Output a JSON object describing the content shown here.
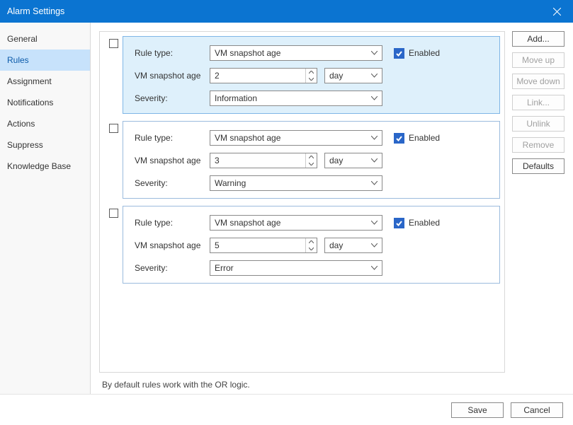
{
  "window": {
    "title": "Alarm Settings"
  },
  "sidebar": {
    "items": [
      {
        "label": "General"
      },
      {
        "label": "Rules",
        "selected": true
      },
      {
        "label": "Assignment"
      },
      {
        "label": "Notifications"
      },
      {
        "label": "Actions"
      },
      {
        "label": "Suppress"
      },
      {
        "label": "Knowledge Base"
      }
    ]
  },
  "labels": {
    "rule_type": "Rule type:",
    "vm_snapshot_age": "VM snapshot age",
    "severity": "Severity:",
    "enabled": "Enabled"
  },
  "rules": [
    {
      "type_value": "VM snapshot age",
      "age_value": "2",
      "unit": "day",
      "severity": "Information",
      "enabled": true,
      "selected": true
    },
    {
      "type_value": "VM snapshot age",
      "age_value": "3",
      "unit": "day",
      "severity": "Warning",
      "enabled": true,
      "selected": false
    },
    {
      "type_value": "VM snapshot age",
      "age_value": "5",
      "unit": "day",
      "severity": "Error",
      "enabled": true,
      "selected": false
    }
  ],
  "footnote": "By default rules work with the OR logic.",
  "side_buttons": {
    "add": "Add...",
    "move_up": "Move up",
    "move_down": "Move down",
    "link": "Link...",
    "unlink": "Unlink",
    "remove": "Remove",
    "defaults": "Defaults"
  },
  "footer": {
    "save": "Save",
    "cancel": "Cancel"
  }
}
